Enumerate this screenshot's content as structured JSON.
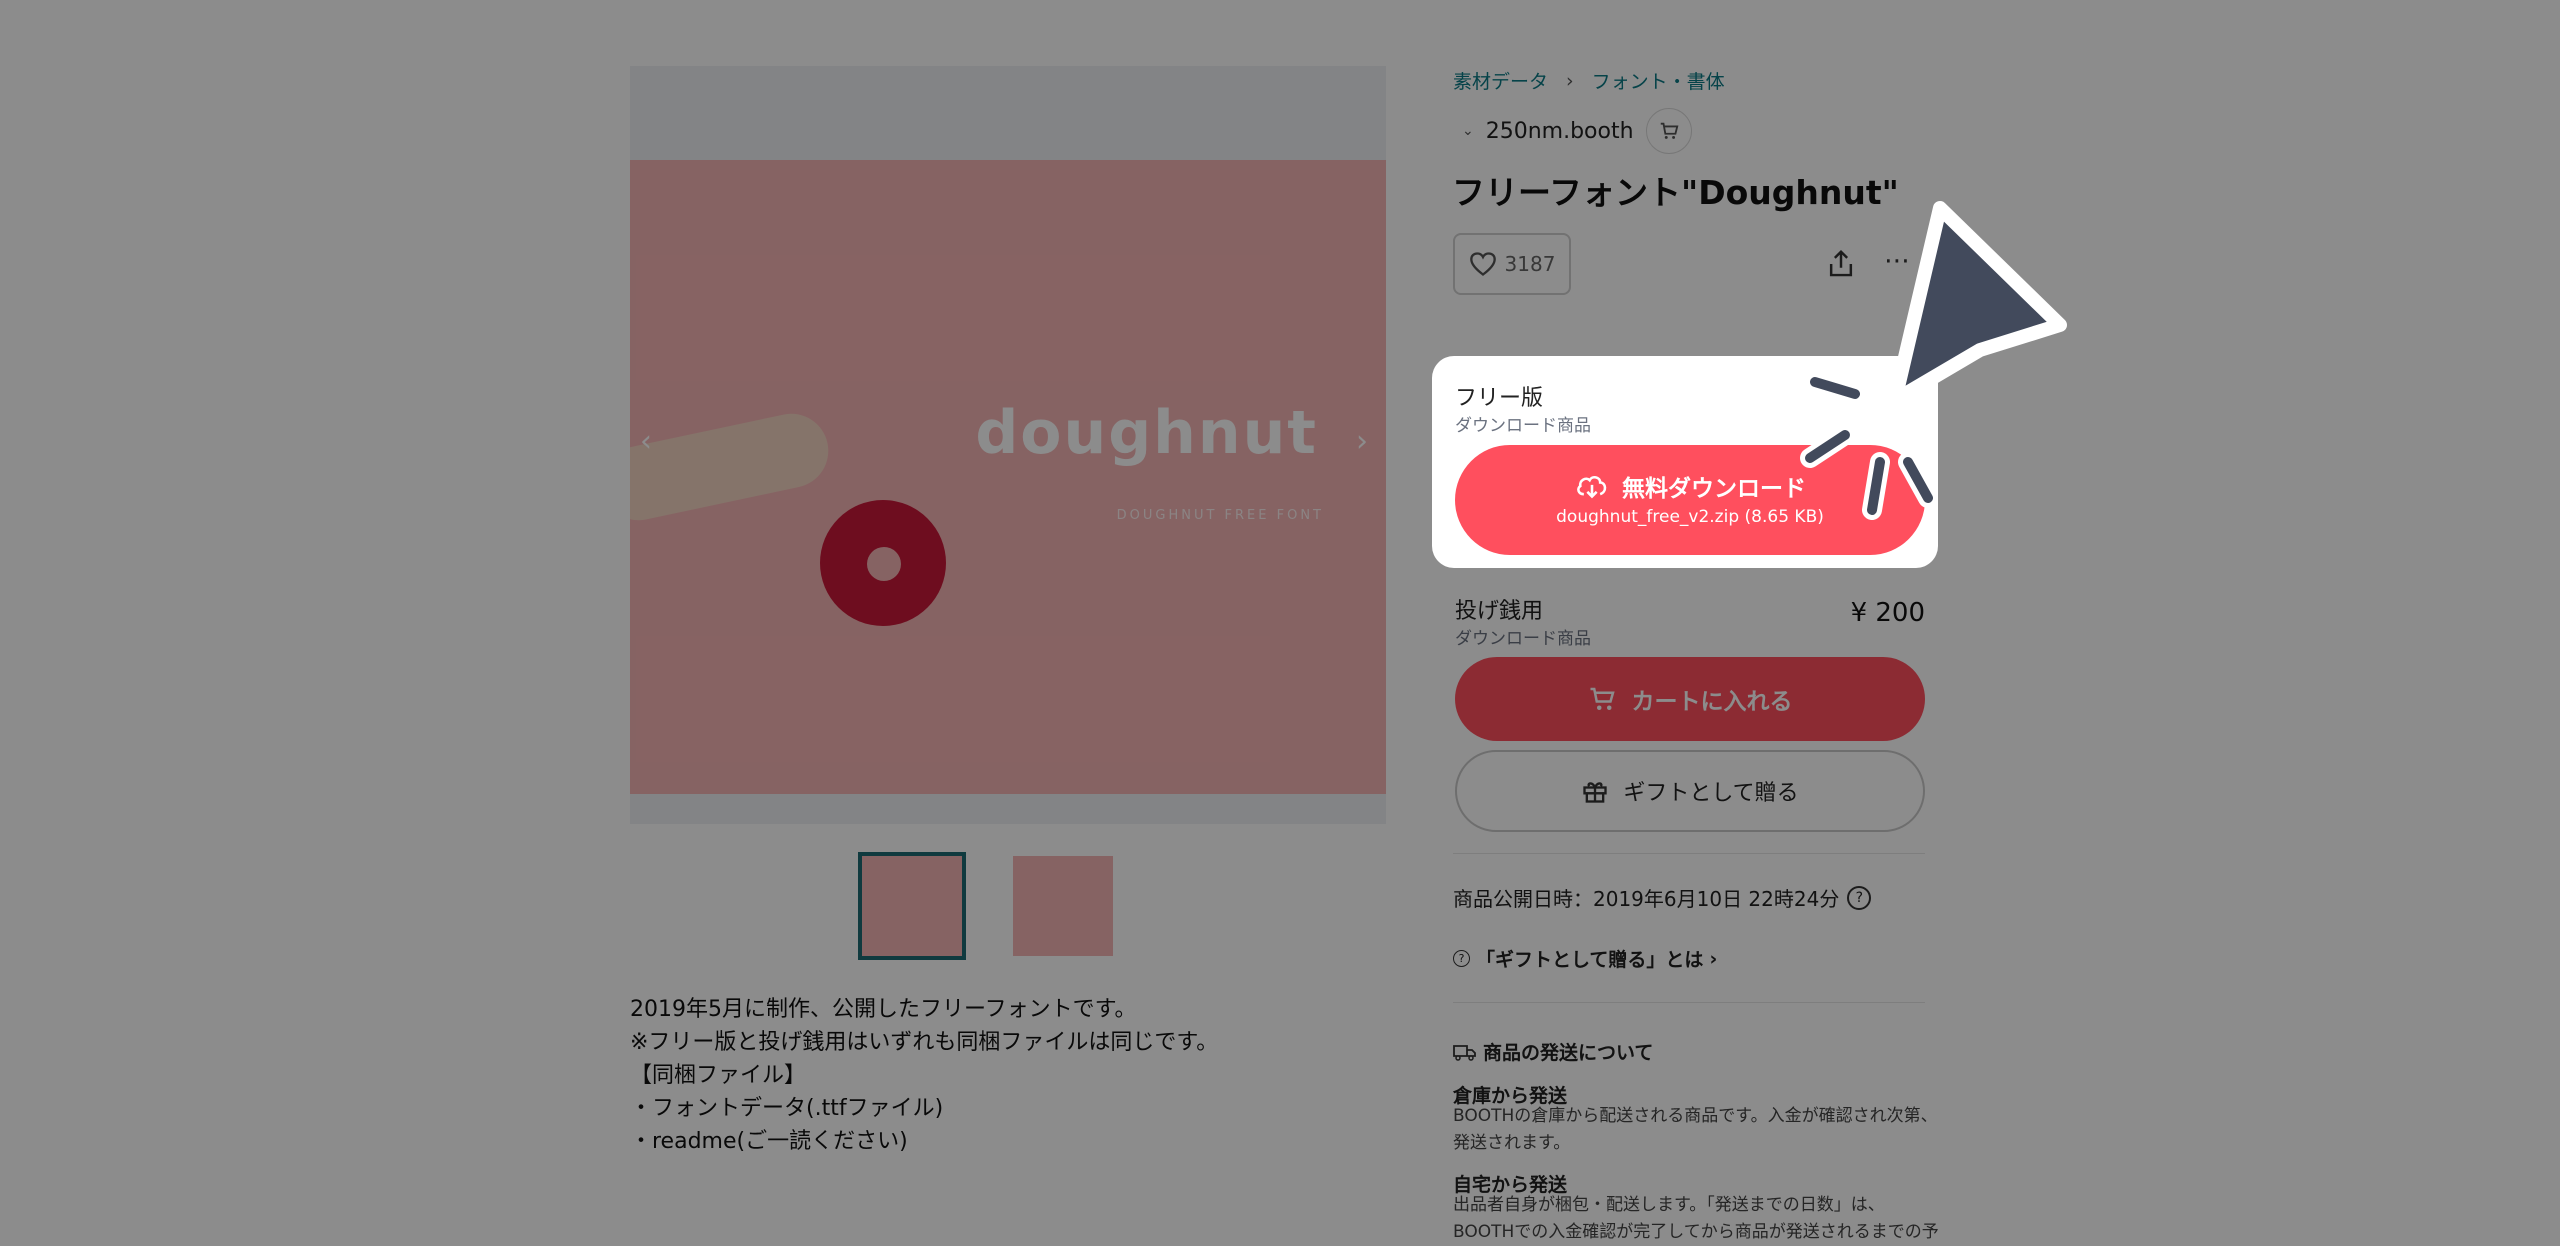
{
  "breadcrumb": {
    "item1": "素材データ",
    "item2": "フォント・書体"
  },
  "shop": {
    "name": "250nm.booth"
  },
  "product": {
    "title": "フリーフォント\"Doughnut\"",
    "like_count": "3187",
    "published": "商品公開日時：2019年6月10日 22時24分",
    "image_wordmark": "doughnut",
    "image_tagline": "DOUGHNUT FREE FONT"
  },
  "variants": {
    "free": {
      "name": "フリー版",
      "type": "ダウンロード商品",
      "download_label": "無料ダウンロード",
      "file": "doughnut_free_v2.zip (8.65 KB)"
    },
    "tip": {
      "name": "投げ銭用",
      "type": "ダウンロード商品",
      "price": "¥ 200",
      "cart_label": "カートに入れる",
      "gift_label": "ギフトとして贈る"
    }
  },
  "gift_help": "「ギフトとして贈る」とは",
  "shipping": {
    "heading": "商品の発送について",
    "warehouse_title": "倉庫から発送",
    "warehouse_text_1": "BOOTHの倉庫から配送される商品です。入金が確認され次第、",
    "warehouse_text_2": "発送されます。",
    "home_title": "自宅から発送",
    "home_text_1": "出品者自身が梱包・配送します。「発送までの日数」は、",
    "home_text_2": "BOOTHでの入金確認が完了してから商品が発送されるまでの予"
  },
  "description": [
    "2019年5月に制作、公開したフリーフォントです。",
    "※フリー版と投げ銭用はいずれも同梱ファイルは同じです。",
    "",
    "【同梱ファイル】",
    "・フォントデータ(.ttfファイル)",
    "・readme(ご一読ください)"
  ],
  "colors": {
    "accent": "#ff4f5e",
    "link": "#0b7a86",
    "thumb_border": "#1e6b74"
  }
}
